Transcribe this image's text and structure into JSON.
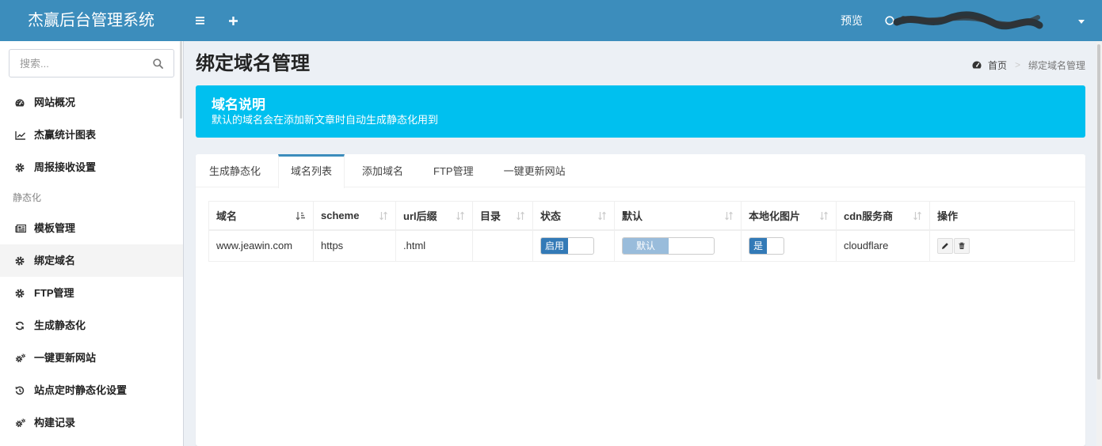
{
  "header": {
    "brand": "杰赢后台管理系统",
    "toggle_icon": "bars-icon",
    "add_icon": "plus-icon",
    "preview_label": "预览",
    "user_icon": "user-circle-icon",
    "dropdown_icon": "caret-down-icon",
    "bar_color": "#3c8dbc"
  },
  "sidebar": {
    "search_placeholder": "搜索...",
    "search_icon": "search-icon",
    "items": [
      {
        "label": "网站概况",
        "icon": "dashboard-icon"
      },
      {
        "label": "杰赢统计图表",
        "icon": "line-chart-icon"
      },
      {
        "label": "周报接收设置",
        "icon": "gear-icon"
      }
    ],
    "section_header": "静态化",
    "static_items": [
      {
        "label": "模板管理",
        "icon": "newspaper-icon"
      },
      {
        "label": "绑定域名",
        "icon": "gear-icon",
        "active": true
      },
      {
        "label": "FTP管理",
        "icon": "gear-icon"
      },
      {
        "label": "生成静态化",
        "icon": "refresh-icon"
      },
      {
        "label": "一键更新网站",
        "icon": "cogs-icon"
      },
      {
        "label": "站点定时静态化设置",
        "icon": "history-icon"
      },
      {
        "label": "构建记录",
        "icon": "cogs-icon"
      }
    ]
  },
  "page": {
    "title": "绑定域名管理",
    "breadcrumb": {
      "home_icon": "dashboard-icon",
      "home": "首页",
      "separator": ">",
      "current": "绑定域名管理"
    }
  },
  "callout": {
    "title": "域名说明",
    "text": "默认的域名会在添加新文章时自动生成静态化用到",
    "color": "#00c0ef"
  },
  "tabs": [
    {
      "label": "生成静态化"
    },
    {
      "label": "域名列表",
      "active": true
    },
    {
      "label": "添加域名"
    },
    {
      "label": "FTP管理"
    },
    {
      "label": "一键更新网站"
    }
  ],
  "table": {
    "columns": [
      "域名",
      "scheme",
      "url后缀",
      "目录",
      "状态",
      "默认",
      "本地化图片",
      "cdn服务商",
      "操作"
    ],
    "sorted_column_icon": "sort-amount-asc-icon",
    "rows": [
      {
        "domain": "www.jeawin.com",
        "scheme": "https",
        "suffix": ".html",
        "directory": "",
        "status": "启用",
        "default": "默认",
        "local_images": "是",
        "cdn": "cloudflare",
        "actions": [
          "pencil-icon",
          "trash-icon"
        ]
      }
    ]
  }
}
